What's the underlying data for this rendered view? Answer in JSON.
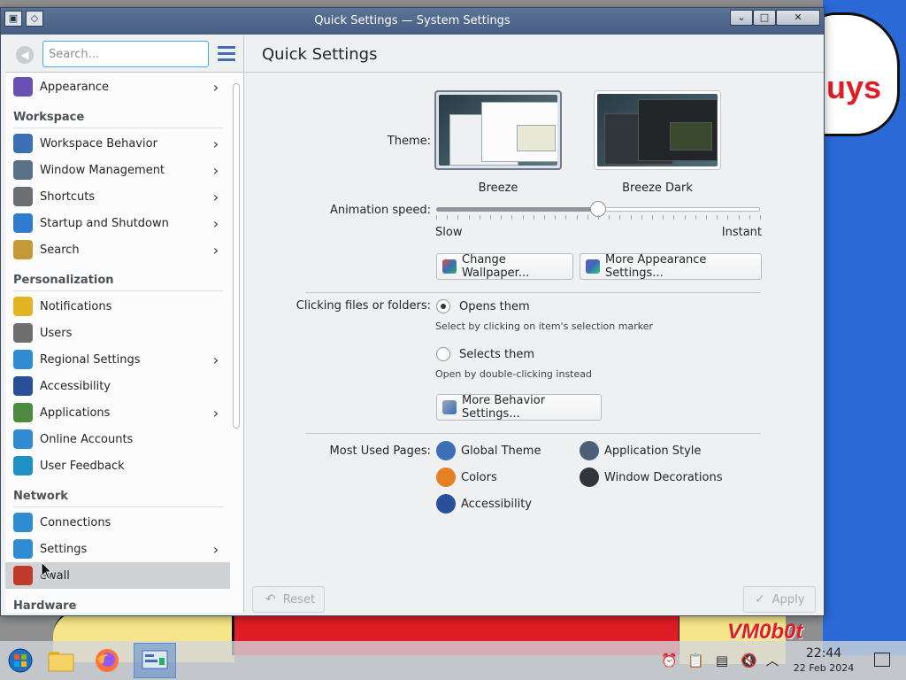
{
  "window": {
    "title": "Quick Settings — System Settings",
    "controls": {
      "minimize": "⌄",
      "maximize": "□",
      "close": "✕"
    }
  },
  "sidebar": {
    "search_placeholder": "Search...",
    "items": [
      {
        "type": "item",
        "label": "Appearance",
        "icon": "appearance-icon",
        "color": "#6a4fb5",
        "arrow": true
      },
      {
        "type": "section",
        "label": "Workspace"
      },
      {
        "type": "item",
        "label": "Workspace Behavior",
        "icon": "workspace-behavior-icon",
        "color": "#3b6fb6",
        "arrow": true
      },
      {
        "type": "item",
        "label": "Window Management",
        "icon": "window-management-icon",
        "color": "#5a6f88",
        "arrow": true
      },
      {
        "type": "item",
        "label": "Shortcuts",
        "icon": "keyboard-icon",
        "color": "#6b6f73",
        "arrow": true
      },
      {
        "type": "item",
        "label": "Startup and Shutdown",
        "icon": "startup-icon",
        "color": "#2f7bcf",
        "arrow": true
      },
      {
        "type": "item",
        "label": "Search",
        "icon": "search-icon",
        "color": "#c49a36",
        "arrow": true
      },
      {
        "type": "section",
        "label": "Personalization"
      },
      {
        "type": "item",
        "label": "Notifications",
        "icon": "bell-icon",
        "color": "#e3b321",
        "arrow": false
      },
      {
        "type": "item",
        "label": "Users",
        "icon": "users-icon",
        "color": "#6e6e6e",
        "arrow": false
      },
      {
        "type": "item",
        "label": "Regional Settings",
        "icon": "globe-icon",
        "color": "#2f8bd2",
        "arrow": true
      },
      {
        "type": "item",
        "label": "Accessibility",
        "icon": "accessibility-icon",
        "color": "#2a4f9a",
        "arrow": false
      },
      {
        "type": "item",
        "label": "Applications",
        "icon": "applications-icon",
        "color": "#4d8a3f",
        "arrow": true
      },
      {
        "type": "item",
        "label": "Online Accounts",
        "icon": "online-accounts-icon",
        "color": "#2f8bd2",
        "arrow": false
      },
      {
        "type": "item",
        "label": "User Feedback",
        "icon": "feedback-icon",
        "color": "#1e90c6",
        "arrow": false
      },
      {
        "type": "section",
        "label": "Network"
      },
      {
        "type": "item",
        "label": "Connections",
        "icon": "connections-icon",
        "color": "#2f8bd2",
        "arrow": false
      },
      {
        "type": "item",
        "label": "Settings",
        "icon": "network-settings-icon",
        "color": "#2f8bd2",
        "arrow": true
      },
      {
        "type": "item",
        "label": "ewall",
        "icon": "firewall-icon",
        "color": "#c0392b",
        "arrow": false,
        "active": true
      },
      {
        "type": "section",
        "label": "Hardware"
      }
    ]
  },
  "main": {
    "title": "Quick Settings",
    "theme_label": "Theme:",
    "themes": [
      {
        "name": "Breeze",
        "selected": true
      },
      {
        "name": "Breeze Dark",
        "selected": false
      }
    ],
    "animation_label": "Animation speed:",
    "animation_value": 0.5,
    "slider_min_label": "Slow",
    "slider_max_label": "Instant",
    "change_wallpaper": "Change Wallpaper...",
    "more_appearance": "More Appearance Settings...",
    "clicking_label": "Clicking files or folders:",
    "opens_them": "Opens them",
    "opens_hint": "Select by clicking on item's selection marker",
    "selects_them": "Selects them",
    "selects_hint": "Open by double-clicking instead",
    "more_behavior": "More Behavior Settings...",
    "most_used_label": "Most Used Pages:",
    "most_used": [
      {
        "label": "Global Theme",
        "icon": "global-theme-icon",
        "color": "#3b6fb6"
      },
      {
        "label": "Application Style",
        "icon": "application-style-icon",
        "color": "#4e5f7a"
      },
      {
        "label": "Colors",
        "icon": "colors-icon",
        "color": "#e67e22"
      },
      {
        "label": "Window Decorations",
        "icon": "window-decorations-icon",
        "color": "#31363b"
      },
      {
        "label": "Accessibility",
        "icon": "accessibility-icon",
        "color": "#2a4f9a"
      }
    ],
    "reset": "Reset",
    "apply": "Apply"
  },
  "taskbar": {
    "apps": [
      "start-menu-icon",
      "file-manager-icon",
      "firefox-icon",
      "system-settings-icon"
    ],
    "tray": [
      "notifications-tray-icon",
      "clipboard-icon",
      "device-notifier-icon",
      "volume-muted-icon",
      "expand-tray-icon"
    ],
    "time": "22:44",
    "date": "22 Feb 2024"
  },
  "wallpaper": {
    "bubble_text": "uys",
    "tag_text": "VM0b0t"
  }
}
